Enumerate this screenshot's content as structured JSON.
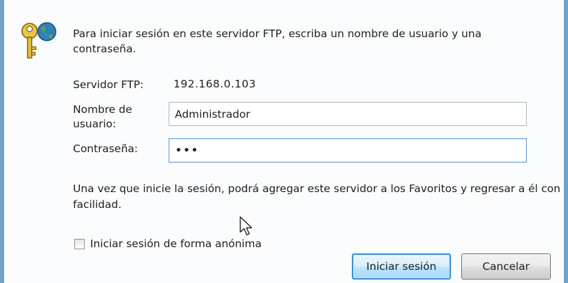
{
  "dialog": {
    "message": "Para iniciar sesión en este servidor FTP, escriba un nombre de usuario y una contraseña.",
    "server_label": "Servidor FTP:",
    "server_value": "192.168.0.103",
    "username_label": "Nombre de usuario:",
    "username_value": "Administrador",
    "password_label": "Contraseña:",
    "password_value": "•••",
    "info_text": "Una vez que inicie la sesión, podrá agregar este servidor a los Favoritos y regresar a él con facilidad.",
    "anonymous_label": "Iniciar sesión de forma anónima",
    "anonymous_checked": false,
    "login_button": "Iniciar sesión",
    "cancel_button": "Cancelar"
  },
  "icons": {
    "dialog_icon": "key-globe-icon",
    "pointer": "mouse-cursor-icon"
  },
  "colors": {
    "frame_border": "#6fa2c9",
    "primary_button_border": "#3c8ed6",
    "focused_input_border": "#5a8fd0"
  }
}
